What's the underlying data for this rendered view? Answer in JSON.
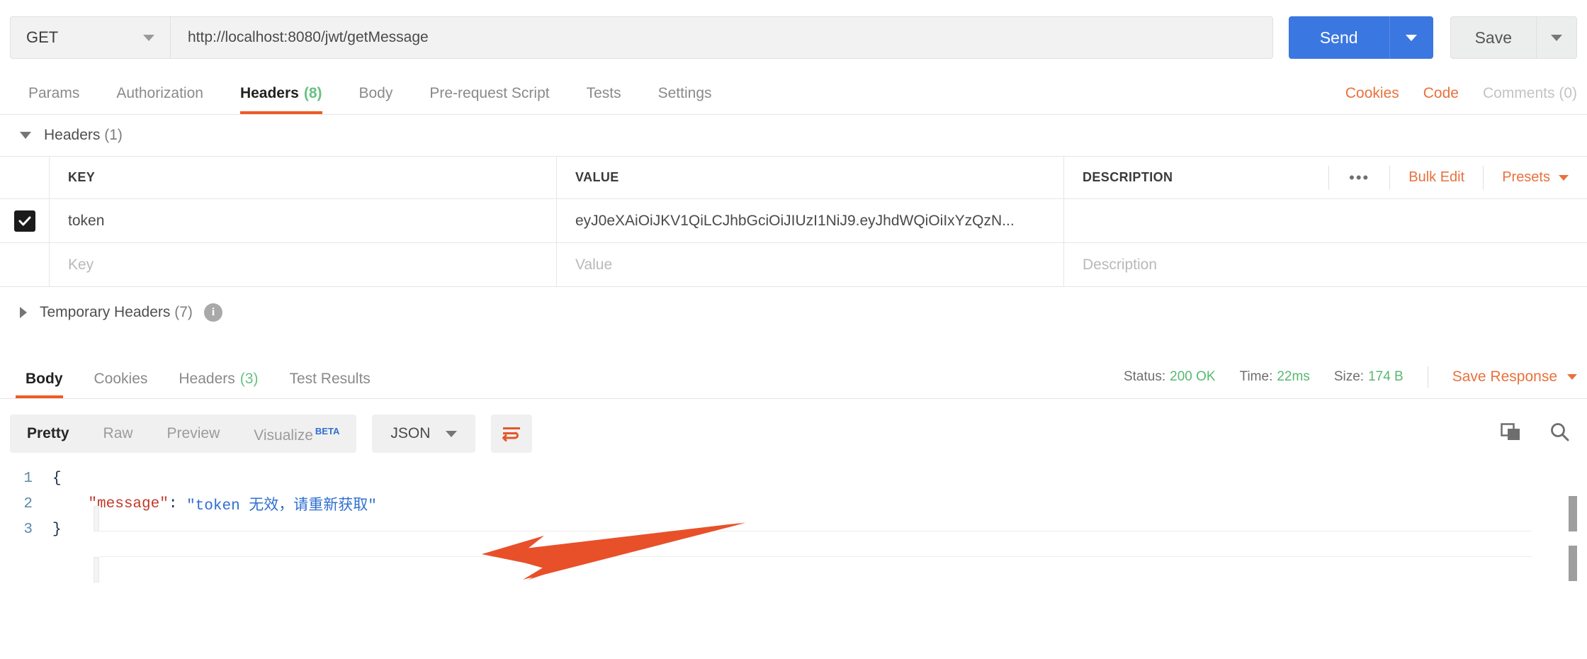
{
  "request": {
    "method": "GET",
    "url": "http://localhost:8080/jwt/getMessage",
    "send_label": "Send",
    "save_label": "Save",
    "tabs": [
      {
        "label": "Params",
        "count": "",
        "active": false
      },
      {
        "label": "Authorization",
        "count": "",
        "active": false
      },
      {
        "label": "Headers",
        "count": "(8)",
        "active": true
      },
      {
        "label": "Body",
        "count": "",
        "active": false
      },
      {
        "label": "Pre-request Script",
        "count": "",
        "active": false
      },
      {
        "label": "Tests",
        "count": "",
        "active": false
      },
      {
        "label": "Settings",
        "count": "",
        "active": false
      }
    ],
    "tabs_right": {
      "cookies": "Cookies",
      "code": "Code",
      "comments": "Comments (0)"
    }
  },
  "headers_section": {
    "title": "Headers",
    "count": "(1)",
    "columns": {
      "key": "KEY",
      "value": "VALUE",
      "description": "DESCRIPTION"
    },
    "tools": {
      "dots": "•••",
      "bulk_edit": "Bulk Edit",
      "presets": "Presets"
    },
    "rows": [
      {
        "checked": true,
        "key": "token",
        "value": "eyJ0eXAiOiJKV1QiLCJhbGciOiJIUzI1NiJ9.eyJhdWQiOiIxYzQzN...",
        "description": ""
      }
    ],
    "placeholder_row": {
      "key": "Key",
      "value": "Value",
      "description": "Description"
    },
    "temporary": {
      "title": "Temporary Headers",
      "count": "(7)",
      "info": "i"
    }
  },
  "response": {
    "tabs": [
      {
        "label": "Body",
        "count": "",
        "active": true
      },
      {
        "label": "Cookies",
        "count": "",
        "active": false
      },
      {
        "label": "Headers",
        "count": "(3)",
        "active": false
      },
      {
        "label": "Test Results",
        "count": "",
        "active": false
      }
    ],
    "meta": {
      "status_label": "Status:",
      "status_value": "200 OK",
      "time_label": "Time:",
      "time_value": "22ms",
      "size_label": "Size:",
      "size_value": "174 B",
      "save_response": "Save Response"
    },
    "toolbar": {
      "views": [
        {
          "label": "Pretty",
          "active": true
        },
        {
          "label": "Raw",
          "active": false
        },
        {
          "label": "Preview",
          "active": false
        },
        {
          "label": "Visualize",
          "active": false,
          "badge": "BETA"
        }
      ],
      "format": "JSON"
    },
    "body_lines": [
      {
        "num": "1",
        "parts": [
          {
            "t": "{",
            "c": "c-punct"
          }
        ]
      },
      {
        "num": "2",
        "parts": [
          {
            "t": "    ",
            "c": "c-punct"
          },
          {
            "t": "\"message\"",
            "c": "c-key"
          },
          {
            "t": ": ",
            "c": "c-punct"
          },
          {
            "t": "\"token 无效，请重新获取\"",
            "c": "c-str"
          }
        ]
      },
      {
        "num": "3",
        "parts": [
          {
            "t": "}",
            "c": "c-punct"
          }
        ]
      }
    ]
  },
  "colors": {
    "accent_orange": "#ef5b25",
    "link_orange": "#e8713c",
    "send_blue": "#3b77e0",
    "green": "#57b96f",
    "arrow": "#e8502a"
  }
}
